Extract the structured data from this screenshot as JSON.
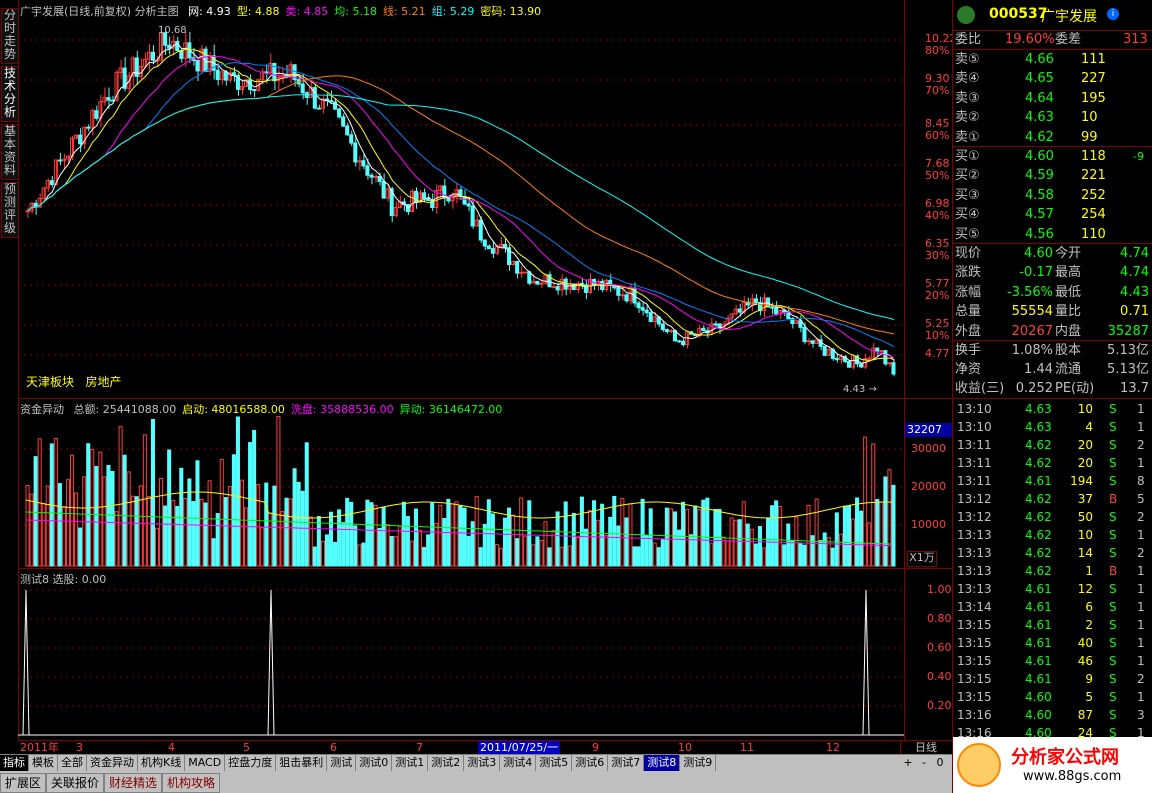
{
  "side_tabs": [
    "分时走势",
    "技术分析",
    "基本资料",
    "预测评级"
  ],
  "main_header": {
    "name": "广宇发展(日线,前复权)",
    "mode": "分析主图",
    "items": [
      {
        "label": "网:",
        "value": "4.93",
        "color": "#ffffff"
      },
      {
        "label": "型:",
        "value": "4.88",
        "color": "#ffff00"
      },
      {
        "label": "类:",
        "value": "4.85",
        "color": "#ff00ff"
      },
      {
        "label": "均:",
        "value": "5.18",
        "color": "#00ff00"
      },
      {
        "label": "线:",
        "value": "5.21",
        "color": "#ff8000"
      },
      {
        "label": "组:",
        "value": "5.29",
        "color": "#00ffff"
      },
      {
        "label": "密码:",
        "value": "13.90",
        "color": "#ffff00"
      }
    ]
  },
  "price_axis": {
    "ticks": [
      {
        "price": "10.22",
        "pct": "80%"
      },
      {
        "price": "9.30",
        "pct": "70%"
      },
      {
        "price": "8.45",
        "pct": "60%"
      },
      {
        "price": "7.68",
        "pct": "50%"
      },
      {
        "price": "6.98",
        "pct": "40%"
      },
      {
        "price": "6.35",
        "pct": "30%"
      },
      {
        "price": "5.77",
        "pct": "20%"
      },
      {
        "price": "5.25",
        "pct": "10%"
      },
      {
        "price": "4.77",
        "pct": ""
      }
    ]
  },
  "annotations": {
    "high": "10.68",
    "low": "4.43",
    "sector": "天津板块",
    "industry": "房地产"
  },
  "vol_header": {
    "title": "资金异动",
    "items": [
      {
        "label": "总额:",
        "value": "25441088.00",
        "color": "#c0c0c0"
      },
      {
        "label": "启动:",
        "value": "48016588.00",
        "color": "#ffff00"
      },
      {
        "label": "洗盘:",
        "value": "35888536.00",
        "color": "#ff00ff"
      },
      {
        "label": "异动:",
        "value": "36146472.00",
        "color": "#00ff00"
      }
    ]
  },
  "vol_axis": {
    "current": "32207",
    "ticks": [
      "30000",
      "20000",
      "10000"
    ],
    "unit": "X1万"
  },
  "ind_header": {
    "title": "测试8",
    "label": "选股:",
    "value": "0.00"
  },
  "ind_axis": {
    "ticks": [
      "1.00",
      "0.80",
      "0.60",
      "0.40",
      "0.20"
    ]
  },
  "date_bar": {
    "labels": [
      "2011年",
      "3",
      "4",
      "5",
      "6",
      "7",
      "2011/07/25/一",
      "9",
      "10",
      "11",
      "12"
    ],
    "period": "日线"
  },
  "chart_data": {
    "type": "candlestick",
    "title": "广宇发展(日线,前复权)",
    "price_range": [
      4.43,
      10.68
    ],
    "selected_date": "2011/07/25",
    "indicator_signals": [
      {
        "month": "2011-01",
        "value": 1
      },
      {
        "month": "2011-04",
        "value": 1
      },
      {
        "month": "2011-12",
        "value": 1
      }
    ]
  },
  "tabs": [
    "指标",
    "模板",
    "全部",
    "资金异动",
    "机构K线",
    "MACD",
    "控盘力度",
    "狙击暴利",
    "测试",
    "测试0",
    "测试1",
    "测试2",
    "测试3",
    "测试4",
    "测试5",
    "测试6",
    "测试7",
    "测试8",
    "测试9"
  ],
  "active_tab": "测试8",
  "status": [
    "扩展区",
    "关联报价",
    "财经精选",
    "机构攻略"
  ],
  "quote": {
    "code": "000537",
    "name": "广宇发展",
    "weibi": {
      "label": "委比",
      "value": "19.60%",
      "label2": "委差",
      "value2": "313"
    },
    "sells": [
      {
        "label": "卖⑤",
        "price": "4.66",
        "vol": "111"
      },
      {
        "label": "卖④",
        "price": "4.65",
        "vol": "227"
      },
      {
        "label": "卖③",
        "price": "4.64",
        "vol": "195"
      },
      {
        "label": "卖②",
        "price": "4.63",
        "vol": "10"
      },
      {
        "label": "卖①",
        "price": "4.62",
        "vol": "99"
      }
    ],
    "buys": [
      {
        "label": "买①",
        "price": "4.60",
        "vol": "118",
        "chg": "-9"
      },
      {
        "label": "买②",
        "price": "4.59",
        "vol": "221",
        "chg": ""
      },
      {
        "label": "买③",
        "price": "4.58",
        "vol": "252",
        "chg": ""
      },
      {
        "label": "买④",
        "price": "4.57",
        "vol": "254",
        "chg": ""
      },
      {
        "label": "买⑤",
        "price": "4.56",
        "vol": "110",
        "chg": ""
      }
    ],
    "stats1": [
      {
        "l1": "现价",
        "v1": "4.60",
        "c1": "#00ff00",
        "l2": "今开",
        "v2": "4.74",
        "c2": "#00ff00"
      },
      {
        "l1": "涨跌",
        "v1": "-0.17",
        "c1": "#00ff00",
        "l2": "最高",
        "v2": "4.74",
        "c2": "#00ff00"
      },
      {
        "l1": "涨幅",
        "v1": "-3.56%",
        "c1": "#00ff00",
        "l2": "最低",
        "v2": "4.43",
        "c2": "#00ff00"
      },
      {
        "l1": "总量",
        "v1": "55554",
        "c1": "#ffff00",
        "l2": "量比",
        "v2": "0.71",
        "c2": "#ffff00"
      },
      {
        "l1": "外盘",
        "v1": "20267",
        "c1": "#ff4040",
        "l2": "内盘",
        "v2": "35287",
        "c2": "#00ff00"
      }
    ],
    "stats2": [
      {
        "l1": "换手",
        "v1": "1.08%",
        "l2": "股本",
        "v2": "5.13亿"
      },
      {
        "l1": "净资",
        "v1": "1.44",
        "l2": "流通",
        "v2": "5.13亿"
      },
      {
        "l1": "收益(三)",
        "v1": "0.252",
        "l2": "PE(动)",
        "v2": "13.7"
      }
    ],
    "ticks": [
      {
        "t": "13:10",
        "p": "4.63",
        "v": "10",
        "d": "S",
        "n": "1"
      },
      {
        "t": "13:10",
        "p": "4.63",
        "v": "4",
        "d": "S",
        "n": "1"
      },
      {
        "t": "13:11",
        "p": "4.62",
        "v": "20",
        "d": "S",
        "n": "2"
      },
      {
        "t": "13:11",
        "p": "4.62",
        "v": "20",
        "d": "S",
        "n": "1"
      },
      {
        "t": "13:11",
        "p": "4.61",
        "v": "194",
        "d": "S",
        "n": "8"
      },
      {
        "t": "13:12",
        "p": "4.62",
        "v": "37",
        "d": "B",
        "n": "5"
      },
      {
        "t": "13:12",
        "p": "4.62",
        "v": "50",
        "d": "S",
        "n": "2"
      },
      {
        "t": "13:13",
        "p": "4.62",
        "v": "10",
        "d": "S",
        "n": "1"
      },
      {
        "t": "13:13",
        "p": "4.62",
        "v": "14",
        "d": "S",
        "n": "2"
      },
      {
        "t": "13:13",
        "p": "4.62",
        "v": "1",
        "d": "B",
        "n": "1"
      },
      {
        "t": "13:13",
        "p": "4.61",
        "v": "12",
        "d": "S",
        "n": "1"
      },
      {
        "t": "13:14",
        "p": "4.61",
        "v": "6",
        "d": "S",
        "n": "1"
      },
      {
        "t": "13:15",
        "p": "4.61",
        "v": "2",
        "d": "S",
        "n": "1"
      },
      {
        "t": "13:15",
        "p": "4.61",
        "v": "40",
        "d": "S",
        "n": "1"
      },
      {
        "t": "13:15",
        "p": "4.61",
        "v": "46",
        "d": "S",
        "n": "1"
      },
      {
        "t": "13:15",
        "p": "4.61",
        "v": "9",
        "d": "S",
        "n": "2"
      },
      {
        "t": "13:15",
        "p": "4.60",
        "v": "5",
        "d": "S",
        "n": "1"
      },
      {
        "t": "13:16",
        "p": "4.60",
        "v": "87",
        "d": "S",
        "n": "3"
      },
      {
        "t": "13:16",
        "p": "4.60",
        "v": "24",
        "d": "S",
        "n": "1"
      }
    ]
  },
  "watermark": {
    "name": "分析家公式网",
    "url": "www.88gs.com"
  },
  "colors": {
    "up": "#ff3c3c",
    "down": "#54ffff",
    "grid": "#800000"
  }
}
